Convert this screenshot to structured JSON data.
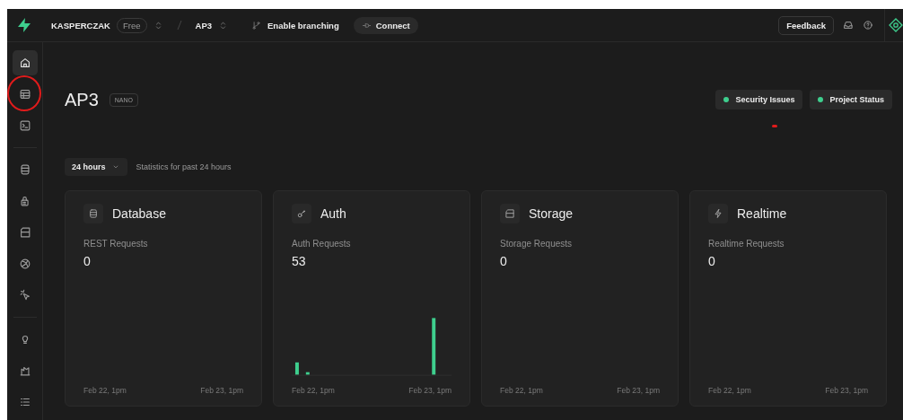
{
  "header": {
    "org": "KASPERCZAK",
    "plan": "Free",
    "project": "AP3",
    "branching": "Enable branching",
    "connect": "Connect",
    "feedback": "Feedback"
  },
  "sidebar": {
    "items": [
      {
        "selected": true,
        "circled": false,
        "group_start": false
      },
      {
        "selected": false,
        "circled": true,
        "group_start": false
      },
      {
        "selected": false,
        "circled": false,
        "group_start": false
      },
      {
        "selected": false,
        "circled": false,
        "group_start": true
      },
      {
        "selected": false,
        "circled": false,
        "group_start": false
      },
      {
        "selected": false,
        "circled": false,
        "group_start": false
      },
      {
        "selected": false,
        "circled": false,
        "group_start": false
      },
      {
        "selected": false,
        "circled": false,
        "group_start": false
      },
      {
        "selected": false,
        "circled": false,
        "group_start": true
      },
      {
        "selected": false,
        "circled": false,
        "group_start": false
      },
      {
        "selected": false,
        "circled": false,
        "group_start": false
      }
    ]
  },
  "project": {
    "title": "AP3",
    "size": "NANO"
  },
  "status_buttons": [
    {
      "label": "Security Issues",
      "color": "#3ecf8e"
    },
    {
      "label": "Project Status",
      "color": "#3ecf8e"
    }
  ],
  "annotation_dot": true,
  "period": {
    "value": "24 hours",
    "description": "Statistics for past 24 hours"
  },
  "cards": [
    {
      "title": "Database",
      "metric": "REST Requests",
      "value": "0",
      "kind": "empty",
      "start": "Feb 22, 1pm",
      "end": "Feb 23, 1pm"
    },
    {
      "title": "Auth",
      "metric": "Auth Requests",
      "value": "53",
      "kind": "bars",
      "start": "Feb 22, 1pm",
      "end": "Feb 23, 1pm"
    },
    {
      "title": "Storage",
      "metric": "Storage Requests",
      "value": "0",
      "kind": "empty",
      "start": "Feb 22, 1pm",
      "end": "Feb 23, 1pm"
    },
    {
      "title": "Realtime",
      "metric": "Realtime Requests",
      "value": "0",
      "kind": "empty",
      "start": "Feb 22, 1pm",
      "end": "Feb 23, 1pm"
    }
  ]
}
